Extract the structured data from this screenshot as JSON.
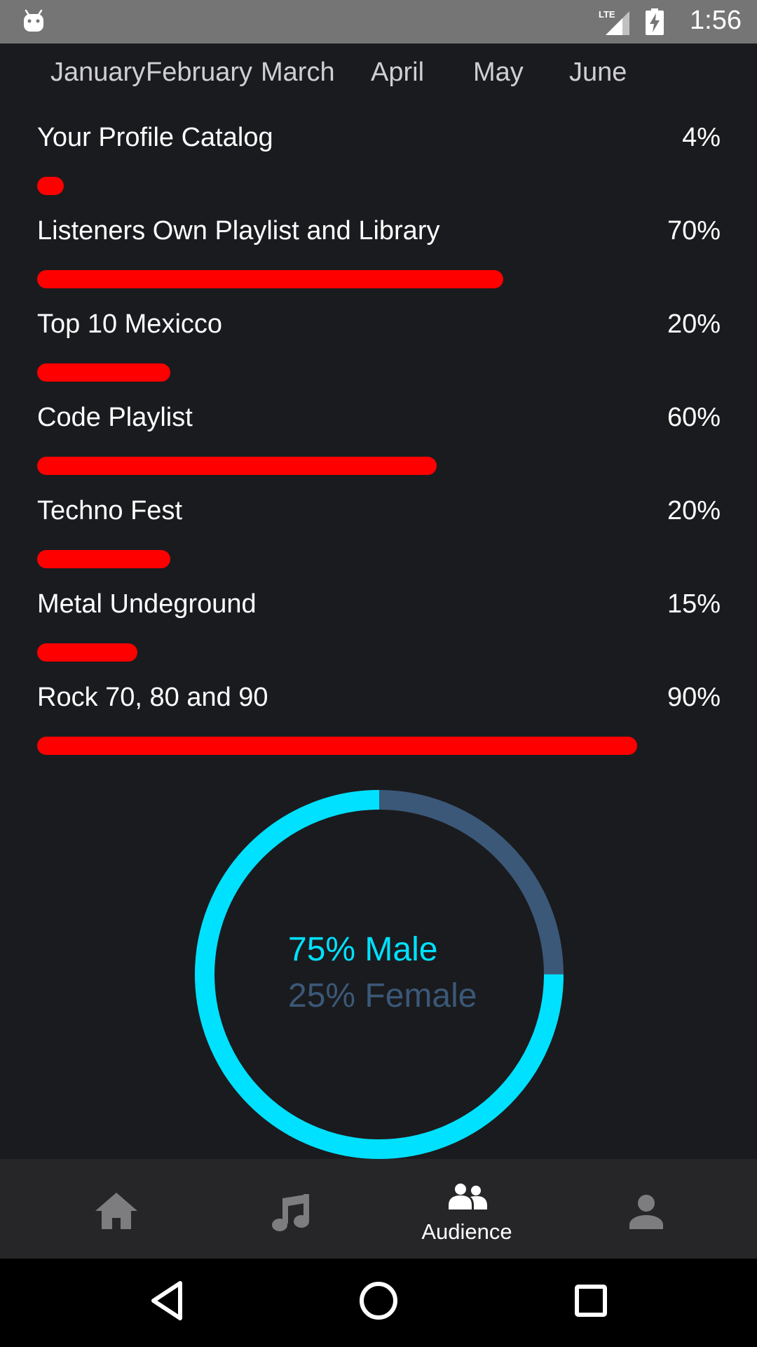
{
  "status_bar": {
    "time": "1:56",
    "network_label": "LTE",
    "icons": [
      "android-icon",
      "lte-signal-icon",
      "battery-charging-icon"
    ]
  },
  "month_tabs": [
    "January",
    "February",
    "March",
    "April",
    "May",
    "June"
  ],
  "catalog": {
    "bar_color": "#ff0000",
    "items": [
      {
        "label": "Your Profile Catalog",
        "percent_text": "4%",
        "value": 4
      },
      {
        "label": "Listeners Own Playlist and Library",
        "percent_text": "70%",
        "value": 70
      },
      {
        "label": "Top 10 Mexicco",
        "percent_text": "20%",
        "value": 20
      },
      {
        "label": "Code Playlist",
        "percent_text": "60%",
        "value": 60
      },
      {
        "label": "Techno Fest",
        "percent_text": "20%",
        "value": 20
      },
      {
        "label": "Metal Undeground",
        "percent_text": "15%",
        "value": 15
      },
      {
        "label": "Rock 70, 80 and 90",
        "percent_text": "90%",
        "value": 90
      }
    ]
  },
  "gender": {
    "male_text": "75% Male",
    "female_text": "25% Female",
    "male_value": 75,
    "female_value": 25,
    "male_color": "#00e1ff",
    "female_color": "#3b5878"
  },
  "bottom_nav": {
    "active_label": "Audience",
    "items": [
      "home-icon",
      "music-note-icon",
      "audience-icon",
      "profile-icon"
    ],
    "active_color": "#ffffff",
    "inactive_color": "#7d7d7f"
  },
  "system_nav": {
    "icons": [
      "back-icon",
      "home-circle-icon",
      "recents-icon"
    ]
  }
}
